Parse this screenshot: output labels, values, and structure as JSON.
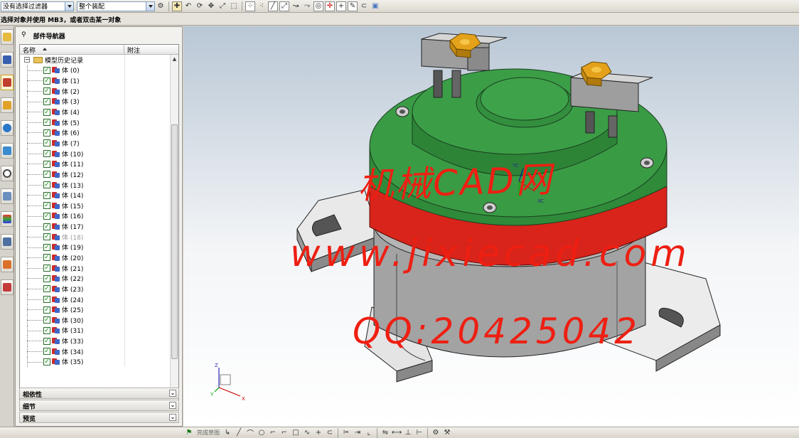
{
  "toolbar": {
    "selection_filter": "没有选择过滤器",
    "assembly_scope": "整个装配",
    "icons": [
      "filter-icon",
      "snap-icon",
      "undo-icon",
      "rotate-icon",
      "pan-icon",
      "select-box-icon",
      "point-icon",
      "line-icon",
      "arc-icon",
      "circle-icon",
      "cross-icon",
      "pencil-icon",
      "cube-icon"
    ]
  },
  "prompt": {
    "text": "选择对象并使用 MB3，或者双击某一对象"
  },
  "resource_bar": {
    "icons": [
      "assembly-navigator-icon",
      "constraint-navigator-icon",
      "part-navigator-icon",
      "reuse-library-icon",
      "web-browser-icon",
      "history-icon",
      "process-studio-icon",
      "roles-icon",
      "system-materials-icon",
      "palette-icon",
      "help-icon"
    ]
  },
  "navigator": {
    "title": "部件导航器",
    "columns": [
      "名称",
      "附注"
    ],
    "root": "模型历史记录",
    "rows": [
      {
        "label": "体 (0)",
        "enabled": true
      },
      {
        "label": "体 (1)",
        "enabled": true
      },
      {
        "label": "体 (2)",
        "enabled": true
      },
      {
        "label": "体 (3)",
        "enabled": true
      },
      {
        "label": "体 (4)",
        "enabled": true
      },
      {
        "label": "体 (5)",
        "enabled": true
      },
      {
        "label": "体 (6)",
        "enabled": true
      },
      {
        "label": "体 (7)",
        "enabled": true
      },
      {
        "label": "体 (10)",
        "enabled": true
      },
      {
        "label": "体 (11)",
        "enabled": true
      },
      {
        "label": "体 (12)",
        "enabled": true
      },
      {
        "label": "体 (13)",
        "enabled": true
      },
      {
        "label": "体 (14)",
        "enabled": true
      },
      {
        "label": "体 (15)",
        "enabled": true
      },
      {
        "label": "体 (16)",
        "enabled": true
      },
      {
        "label": "体 (17)",
        "enabled": true
      },
      {
        "label": "体 (18)",
        "enabled": false
      },
      {
        "label": "体 (19)",
        "enabled": true
      },
      {
        "label": "体 (20)",
        "enabled": true
      },
      {
        "label": "体 (21)",
        "enabled": true
      },
      {
        "label": "体 (22)",
        "enabled": true
      },
      {
        "label": "体 (23)",
        "enabled": true
      },
      {
        "label": "体 (24)",
        "enabled": true
      },
      {
        "label": "体 (25)",
        "enabled": true
      },
      {
        "label": "体 (30)",
        "enabled": true
      },
      {
        "label": "体 (31)",
        "enabled": true
      },
      {
        "label": "体 (33)",
        "enabled": true
      },
      {
        "label": "体 (34)",
        "enabled": true
      },
      {
        "label": "体 (35)",
        "enabled": true
      }
    ],
    "sections": {
      "dependencies": "相依性",
      "details": "细节",
      "preview": "预览"
    }
  },
  "viewport": {
    "watermark_line1": "机械CAD网",
    "watermark_line2": "www.jixiecad.com",
    "watermark_line3": "QQ:20425042",
    "wcs_x": "XC",
    "wcs_y": "YC",
    "triad_x": "X",
    "triad_y": "Y",
    "triad_z": "Z",
    "colors": {
      "green": "#2f8a3a",
      "red": "#d8241a",
      "gray": "#a4a4a4",
      "nut": "#e3a21a"
    }
  },
  "bottom_toolbar": {
    "sketch_label": "完成草图"
  }
}
